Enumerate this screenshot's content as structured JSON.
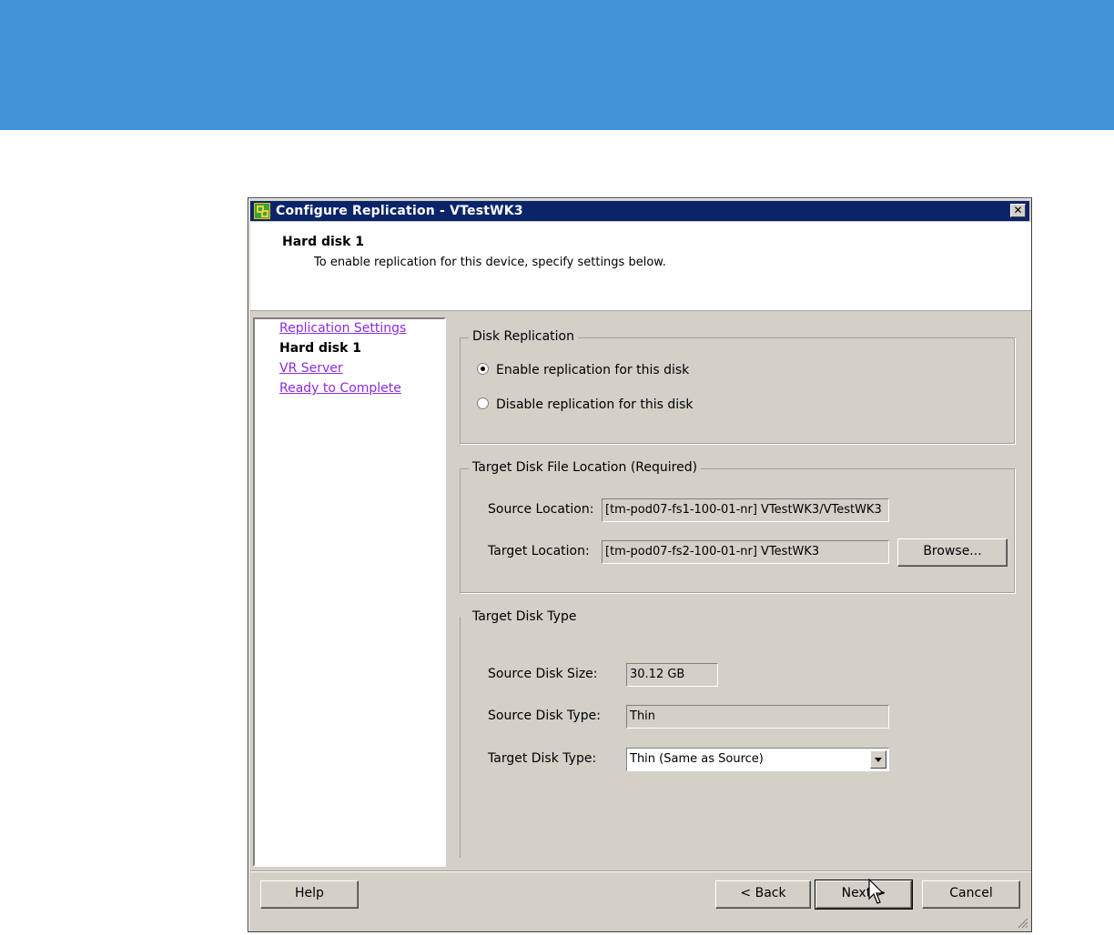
{
  "dialog": {
    "title": "Configure Replication - VTestWK3",
    "close_symbol": "✕",
    "header": {
      "title": "Hard disk 1",
      "subtitle": "To enable replication for this device, specify settings below."
    }
  },
  "nav": {
    "items": [
      {
        "label": "Replication Settings",
        "state": "link"
      },
      {
        "label": "Hard disk 1",
        "state": "current"
      },
      {
        "label": "VR Server",
        "state": "link"
      },
      {
        "label": "Ready to Complete",
        "state": "link"
      }
    ]
  },
  "disk_replication": {
    "legend": "Disk Replication",
    "enable_label": "Enable replication for this disk",
    "disable_label": "Disable replication for this disk",
    "selected": "enable"
  },
  "target_location": {
    "legend": "Target Disk File Location (Required)",
    "source_label": "Source Location:",
    "source_value": "[tm-pod07-fs1-100-01-nr] VTestWK3/VTestWK3",
    "target_label": "Target Location:",
    "target_value": "[tm-pod07-fs2-100-01-nr] VTestWK3",
    "browse_label": "Browse..."
  },
  "disk_type": {
    "legend": "Target Disk Type",
    "size_label": "Source Disk Size:",
    "size_value": "30.12 GB",
    "source_type_label": "Source Disk Type:",
    "source_type_value": "Thin",
    "target_type_label": "Target Disk Type:",
    "target_type_value": "Thin (Same as Source)"
  },
  "buttons": {
    "help": "Help",
    "back": "< Back",
    "next": "Next >",
    "cancel": "Cancel"
  },
  "colors": {
    "banner": "#4294d8",
    "titlebar": "#0a246a",
    "dialog_bg": "#d4d0c8",
    "link": "#8a2be2"
  }
}
